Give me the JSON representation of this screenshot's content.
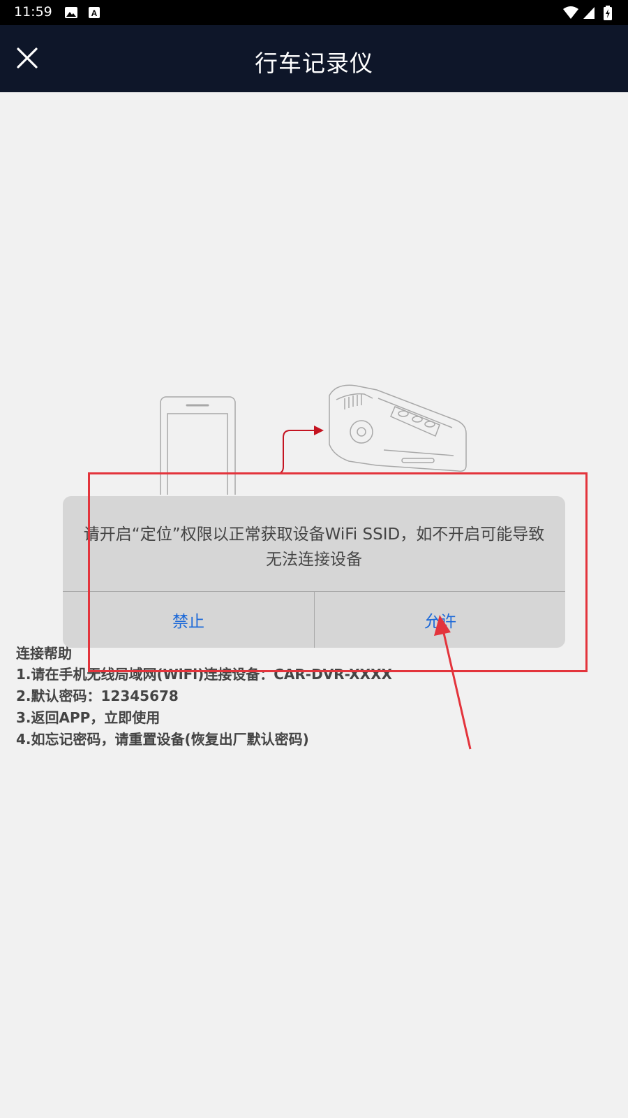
{
  "status_bar": {
    "time": "11:59",
    "icons": [
      "image-icon",
      "a-letter-icon",
      "wifi-icon",
      "signal-icon",
      "battery-icon"
    ]
  },
  "app_bar": {
    "title": "行车记录仪",
    "close_icon": "close-icon",
    "background": "#0e1629"
  },
  "dialog": {
    "message_line1": "请开启“定位”权限以正常获取设备WiFi SSID，如不开启可能导致",
    "message_line2": "无法连接设备",
    "deny_label": "禁止",
    "allow_label": "允许",
    "button_color": "#1e6ad8"
  },
  "help": {
    "title": "连接帮助",
    "lines": [
      "1.请在手机无线局域网(WiFi)连接设备：CAR-DVR-XXXX",
      "2.默认密码：12345678",
      "3.返回APP，立即使用",
      "4.如忘记密码，请重置设备(恢复出厂默认密码)"
    ]
  },
  "annotation_color": "#e3343c"
}
